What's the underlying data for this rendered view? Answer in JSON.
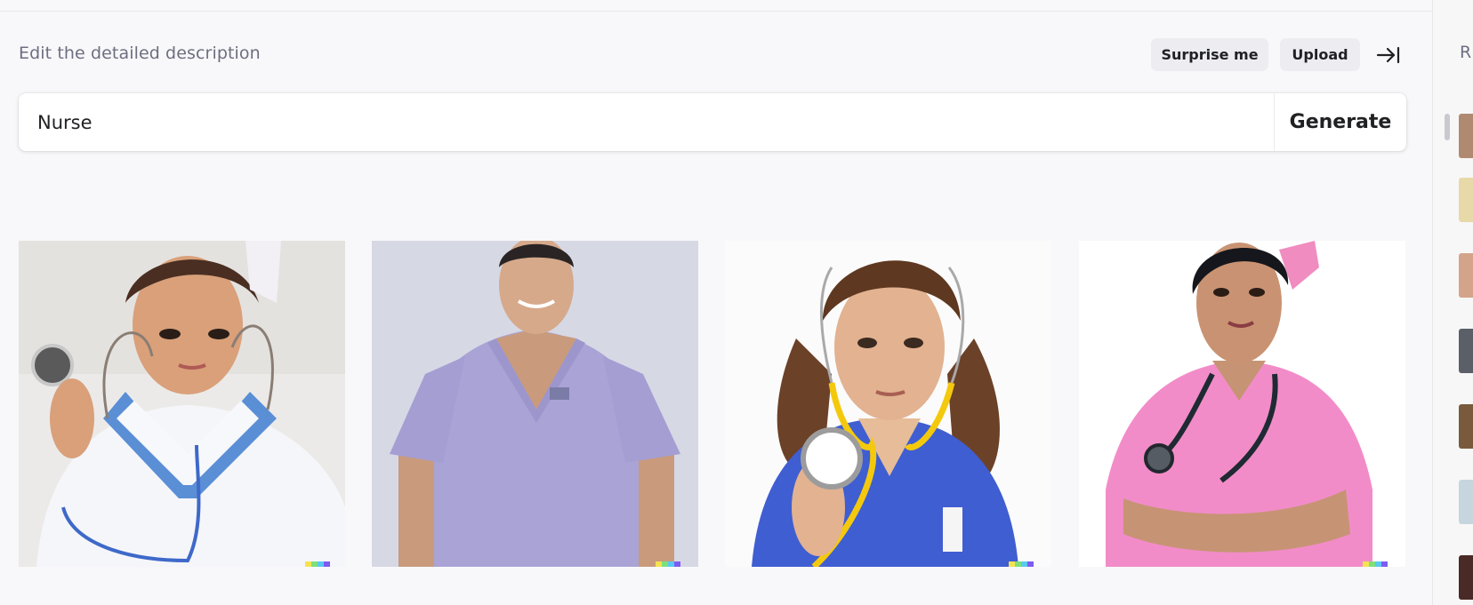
{
  "header": {
    "description_label": "Edit the detailed description",
    "surprise_label": "Surprise me",
    "upload_label": "Upload"
  },
  "prompt": {
    "value": "Nurse",
    "generate_label": "Generate"
  },
  "results": [
    {
      "subject": "nurse in white uniform with blue stethoscope",
      "uniform_color": "#ffffff"
    },
    {
      "subject": "nurse in lavender scrubs",
      "uniform_color": "#a9a3d6"
    },
    {
      "subject": "nurse in blue scrubs with yellow stethoscope",
      "uniform_color": "#3f5ed1"
    },
    {
      "subject": "nurse in pink scrubs with arms crossed",
      "uniform_color": "#f28cc8"
    }
  ],
  "history_panel": {
    "heading_initial": "R",
    "thumbnail_count": 7
  },
  "colors": {
    "background": "#f8f8fa",
    "button_bg": "#ececf1",
    "muted_text": "#6e6e80",
    "text": "#202123"
  }
}
